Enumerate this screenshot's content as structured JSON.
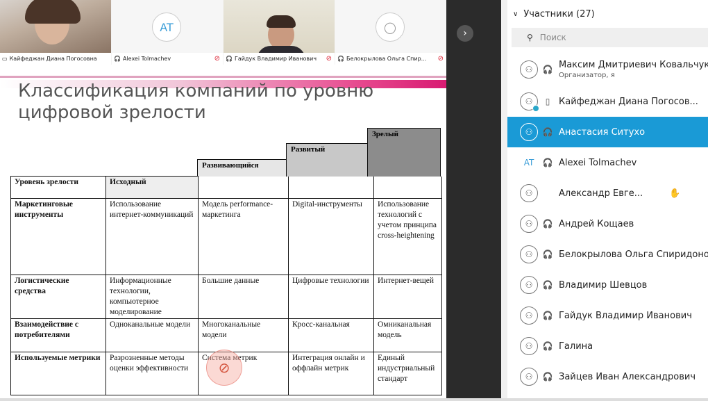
{
  "video_tiles": [
    {
      "name": "Кайфеджан Диана Погосовна",
      "type": "video",
      "active": true
    },
    {
      "name": "Alexei Tolmachev",
      "initials": "AT",
      "type": "avatar"
    },
    {
      "name": "Гайдук Владимир Иванович",
      "type": "video"
    },
    {
      "name": "Белокрылова Ольга Спир...",
      "type": "avatar"
    }
  ],
  "slide": {
    "title": "Классификация компаний по уровню цифровой зрелости",
    "steps": [
      "Развивающийся",
      "Развитый",
      "Зрелый"
    ],
    "table": {
      "header": [
        "Уровень зрелости",
        "Исходный"
      ],
      "rows": [
        [
          "Маркетинговые инструменты",
          "Использование интернет-коммуникаций",
          "Модель performance-маркетинга",
          "Digital-инструменты",
          "Использование технологий с учетом принципа cross-heightening"
        ],
        [
          "Логистические средства",
          "Информационные технологии, компьютерное моделирование",
          "Большие данные",
          "Цифровые технологии",
          "Интернет-вещей"
        ],
        [
          "Взаимодействие с потребителями",
          "Одноканальные модели",
          "Многоканальные модели",
          "Кросс-канальная",
          "Омниканальная модель"
        ],
        [
          "Используемые метрики",
          "Разрозненные методы оценки эффективности",
          "Система метрик",
          "Интеграция онлайн и оффлайн метрик",
          "Единый индустриальный стандарт"
        ]
      ]
    }
  },
  "sidebar": {
    "header": "Участники (27)",
    "search_placeholder": "Поиск",
    "participants": [
      {
        "name": "Максим Дмитриевич Ковальчук",
        "sub": "Организатор, я",
        "device": "headset"
      },
      {
        "name": "Кайфеджан Диана Погосов...",
        "device": "phone"
      },
      {
        "name": "Анастасия Ситухо",
        "device": "headset",
        "selected": true
      },
      {
        "name": "Alexei Tolmachev",
        "initials": "AT",
        "device": "headset"
      },
      {
        "name": "Александр Евге...",
        "device": "none",
        "hand": true
      },
      {
        "name": "Андрей Кощаев",
        "device": "headset"
      },
      {
        "name": "Белокрылова Ольга Спиридоновна",
        "device": "headset"
      },
      {
        "name": "Владимир Шевцов",
        "device": "headset"
      },
      {
        "name": "Гайдук Владимир Иванович",
        "device": "headset"
      },
      {
        "name": "Галина",
        "device": "headset"
      },
      {
        "name": "Зайцев Иван Александрович",
        "device": "headset"
      }
    ]
  },
  "colors": {
    "accent": "#1a9ad6",
    "pink": "#d81b72"
  }
}
